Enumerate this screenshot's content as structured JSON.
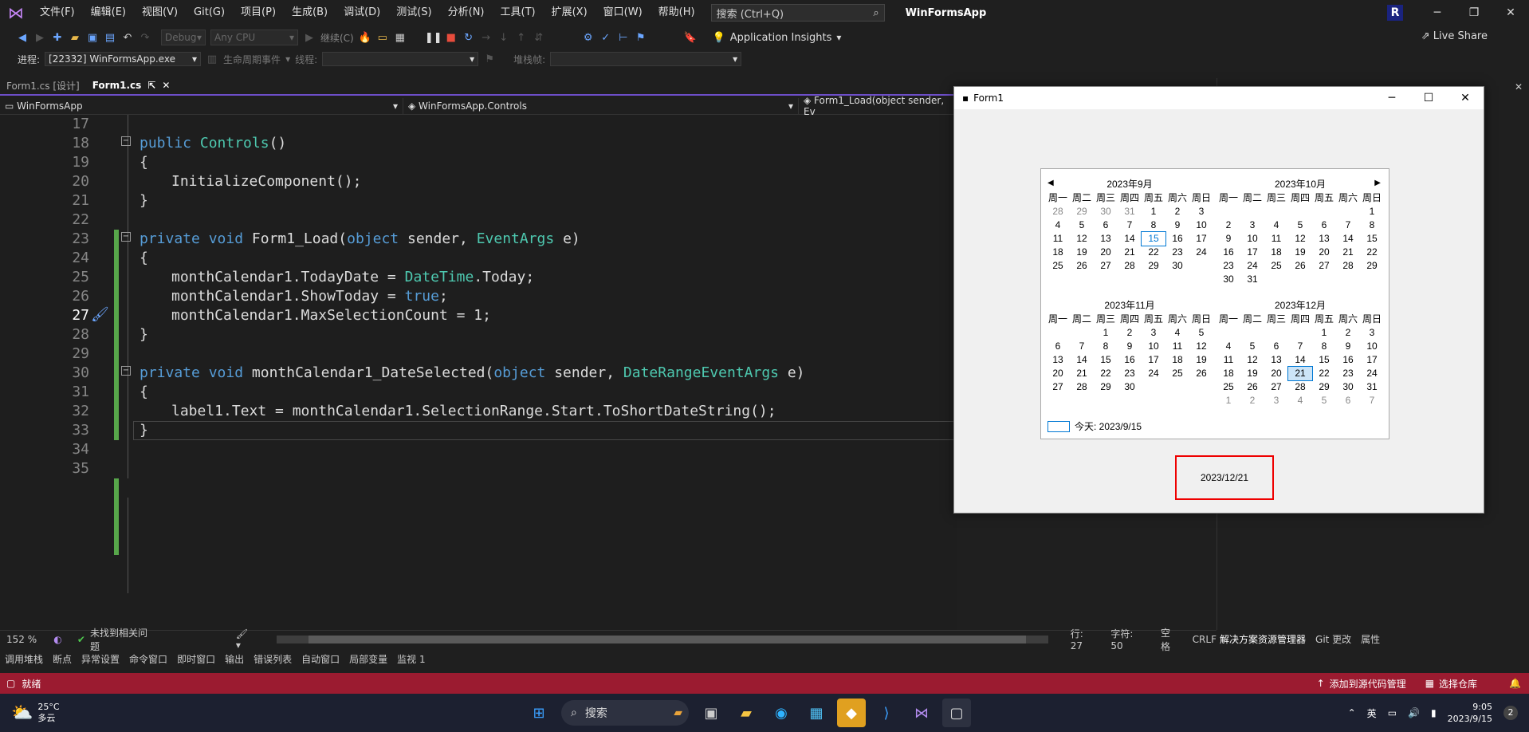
{
  "menubar": {
    "items": [
      "文件(F)",
      "编辑(E)",
      "视图(V)",
      "Git(G)",
      "项目(P)",
      "生成(B)",
      "调试(D)",
      "测试(S)",
      "分析(N)",
      "工具(T)",
      "扩展(X)",
      "窗口(W)",
      "帮助(H)"
    ],
    "search_placeholder": "搜索 (Ctrl+Q)",
    "app_title": "WinFormsApp",
    "user_initial": "R"
  },
  "toolbar": {
    "config": "Debug",
    "platform": "Any CPU",
    "continue_label": "继续(C)",
    "app_insights": "Application Insights",
    "live_share": "Live Share"
  },
  "toolbar2": {
    "process_label": "进程:",
    "process_value": "[22332] WinFormsApp.exe",
    "lifecycle_label": "生命周期事件",
    "thread_label": "线程:",
    "stack_label": "堆栈帧:"
  },
  "tabs": [
    {
      "label": "Form1.cs [设计]",
      "active": false
    },
    {
      "label": "Form1.cs",
      "active": true
    }
  ],
  "navbar": {
    "project": "WinFormsApp",
    "class": "WinFormsApp.Controls",
    "member": "Form1_Load(object sender, Ev"
  },
  "editor": {
    "line_numbers": [
      "17",
      "18",
      "19",
      "20",
      "21",
      "22",
      "23",
      "24",
      "25",
      "26",
      "27",
      "28",
      "29",
      "30",
      "31",
      "32",
      "33",
      "34",
      "35"
    ],
    "zoom": "152 %",
    "issues": "未找到相关问题",
    "row": "行: 27",
    "col": "字符: 50",
    "whitespace": "空格",
    "eol": "CRLF"
  },
  "form1": {
    "title": "Form1",
    "label1": "2023/12/21",
    "calendar": {
      "weekdays": [
        "周一",
        "周二",
        "周三",
        "周四",
        "周五",
        "周六",
        "周日"
      ],
      "today_text": "今天: 2023/9/15",
      "months": [
        {
          "title": "2023年9月",
          "days": [
            "28",
            "29",
            "30",
            "31",
            "1",
            "2",
            "3",
            "4",
            "5",
            "6",
            "7",
            "8",
            "9",
            "10",
            "11",
            "12",
            "13",
            "14",
            "15",
            "16",
            "17",
            "18",
            "19",
            "20",
            "21",
            "22",
            "23",
            "24",
            "25",
            "26",
            "27",
            "28",
            "29",
            "30"
          ],
          "trail_start": 4,
          "today": "15"
        },
        {
          "title": "2023年10月",
          "days": [
            "",
            "",
            "",
            "",
            "",
            "",
            "1",
            "2",
            "3",
            "4",
            "5",
            "6",
            "7",
            "8",
            "9",
            "10",
            "11",
            "12",
            "13",
            "14",
            "15",
            "16",
            "17",
            "18",
            "19",
            "20",
            "21",
            "22",
            "23",
            "24",
            "25",
            "26",
            "27",
            "28",
            "29",
            "30",
            "31"
          ]
        },
        {
          "title": "2023年11月",
          "days": [
            "",
            "",
            "1",
            "2",
            "3",
            "4",
            "5",
            "6",
            "7",
            "8",
            "9",
            "10",
            "11",
            "12",
            "13",
            "14",
            "15",
            "16",
            "17",
            "18",
            "19",
            "20",
            "21",
            "22",
            "23",
            "24",
            "25",
            "26",
            "27",
            "28",
            "29",
            "30"
          ]
        },
        {
          "title": "2023年12月",
          "days": [
            "",
            "",
            "",
            "",
            "1",
            "2",
            "3",
            "4",
            "5",
            "6",
            "7",
            "8",
            "9",
            "10",
            "11",
            "12",
            "13",
            "14",
            "15",
            "16",
            "17",
            "18",
            "19",
            "20",
            "21",
            "22",
            "23",
            "24",
            "25",
            "26",
            "27",
            "28",
            "29",
            "30",
            "31",
            "1",
            "2",
            "3",
            "4",
            "5",
            "6",
            "7"
          ],
          "trail_end": 7,
          "selected": "21"
        }
      ]
    }
  },
  "bottom_tabs": [
    "调用堆栈",
    "断点",
    "异常设置",
    "命令窗口",
    "即时窗口",
    "输出",
    "错误列表",
    "自动窗口",
    "局部变量",
    "监视 1"
  ],
  "right_tabs": [
    "解决方案资源管理器",
    "Git 更改",
    "属性"
  ],
  "statusbar": {
    "ready": "就绪",
    "add_source": "添加到源代码管理",
    "select_repo": "选择仓库"
  },
  "taskbar": {
    "weather_temp": "25°C",
    "weather_desc": "多云",
    "search": "搜索",
    "ime": "英",
    "time": "9:05",
    "date": "2023/9/15",
    "notifications": "2"
  }
}
